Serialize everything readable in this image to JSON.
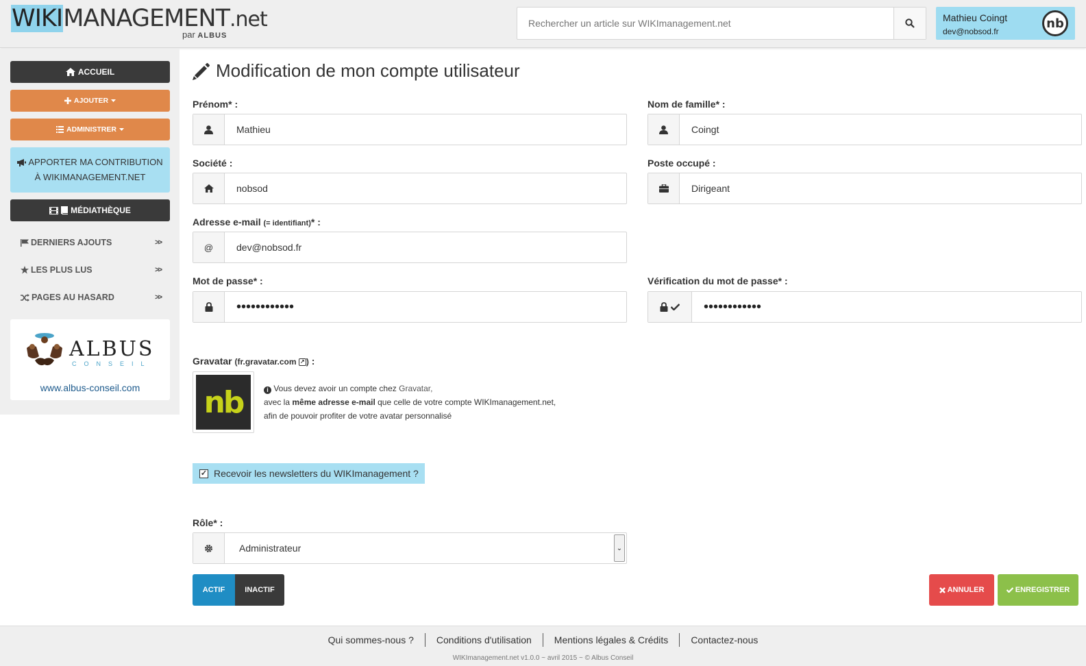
{
  "header": {
    "logo_wiki": "WIKI",
    "logo_management": "MANAGEMENT",
    "logo_net": ".net",
    "logo_par": "par",
    "logo_albus": "ALBUS",
    "search_placeholder": "Rechercher un article sur WIKImanagement.net",
    "user_name": "Mathieu Coingt",
    "user_email": "dev@nobsod.fr",
    "avatar_initials": "nb"
  },
  "sidebar": {
    "accueil": "ACCUEIL",
    "ajouter": "AJOUTER",
    "administrer": "ADMINISTRER",
    "contribution_line1": "APPORTER MA CONTRIBUTION",
    "contribution_line2": "À WIKIMANAGEMENT.NET",
    "mediatheque": "MÉDIATHÈQUE",
    "nav": [
      {
        "label": "DERNIERS AJOUTS",
        "icon": "flag-icon"
      },
      {
        "label": "LES PLUS LUS",
        "icon": "star-icon"
      },
      {
        "label": "PAGES AU HASARD",
        "icon": "shuffle-icon"
      }
    ],
    "chevron": ">>",
    "albus_name": "ALBUS",
    "albus_sub": "CONSEIL",
    "albus_link": "www.albus-conseil.com"
  },
  "form": {
    "title": "Modification de mon compte utilisateur",
    "prenom_label": "Prénom* :",
    "prenom_value": "Mathieu",
    "nom_label": "Nom de famille* :",
    "nom_value": "Coingt",
    "societe_label": "Société :",
    "societe_value": "nobsod",
    "poste_label": "Poste occupé :",
    "poste_value": "Dirigeant",
    "email_label_main": "Adresse e-mail",
    "email_label_small": "(= identifiant)",
    "email_label_end": "* :",
    "email_addon": "@",
    "email_value": "dev@nobsod.fr",
    "password_label": "Mot de passe* :",
    "password_value": "••••••••••••",
    "password_verif_label": "Vérification du mot de passe* :",
    "password_verif_value": "••••••••••••",
    "gravatar_label": "Gravatar",
    "gravatar_site": "fr.gravatar.com",
    "gravatar_colon": ":",
    "gravatar_initials": "nb",
    "gravatar_line1_a": "Vous devez avoir un compte chez",
    "gravatar_line1_link": "Gravatar,",
    "gravatar_line2_a": "avec la",
    "gravatar_line2_b": "même adresse e-mail",
    "gravatar_line2_c": "que celle de votre compte WIKImanagement.net,",
    "gravatar_line3": "afin de pouvoir profiter de votre avatar personnalisé",
    "newsletter_label": "Recevoir les newsletters du WIKImanagement ?",
    "newsletter_checked": true,
    "role_label": "Rôle* :",
    "role_value": "Administrateur",
    "actif": "ACTIF",
    "inactif": "INACTIF",
    "annuler": "ANNULER",
    "enregistrer": "ENREGISTRER"
  },
  "footer": {
    "links": [
      "Qui sommes-nous ?",
      "Conditions d'utilisation",
      "Mentions légales & Crédits",
      "Contactez-nous"
    ],
    "copyright": "WIKImanagement.net v1.0.0 ~ avril 2015 ~ © Albus Conseil"
  },
  "colors": {
    "accent_blue": "#1f8dc4",
    "light_blue": "#a8dff2",
    "orange": "#e0884a",
    "dark": "#3a3a3a",
    "danger": "#e54b4b",
    "success": "#8cc04a"
  }
}
